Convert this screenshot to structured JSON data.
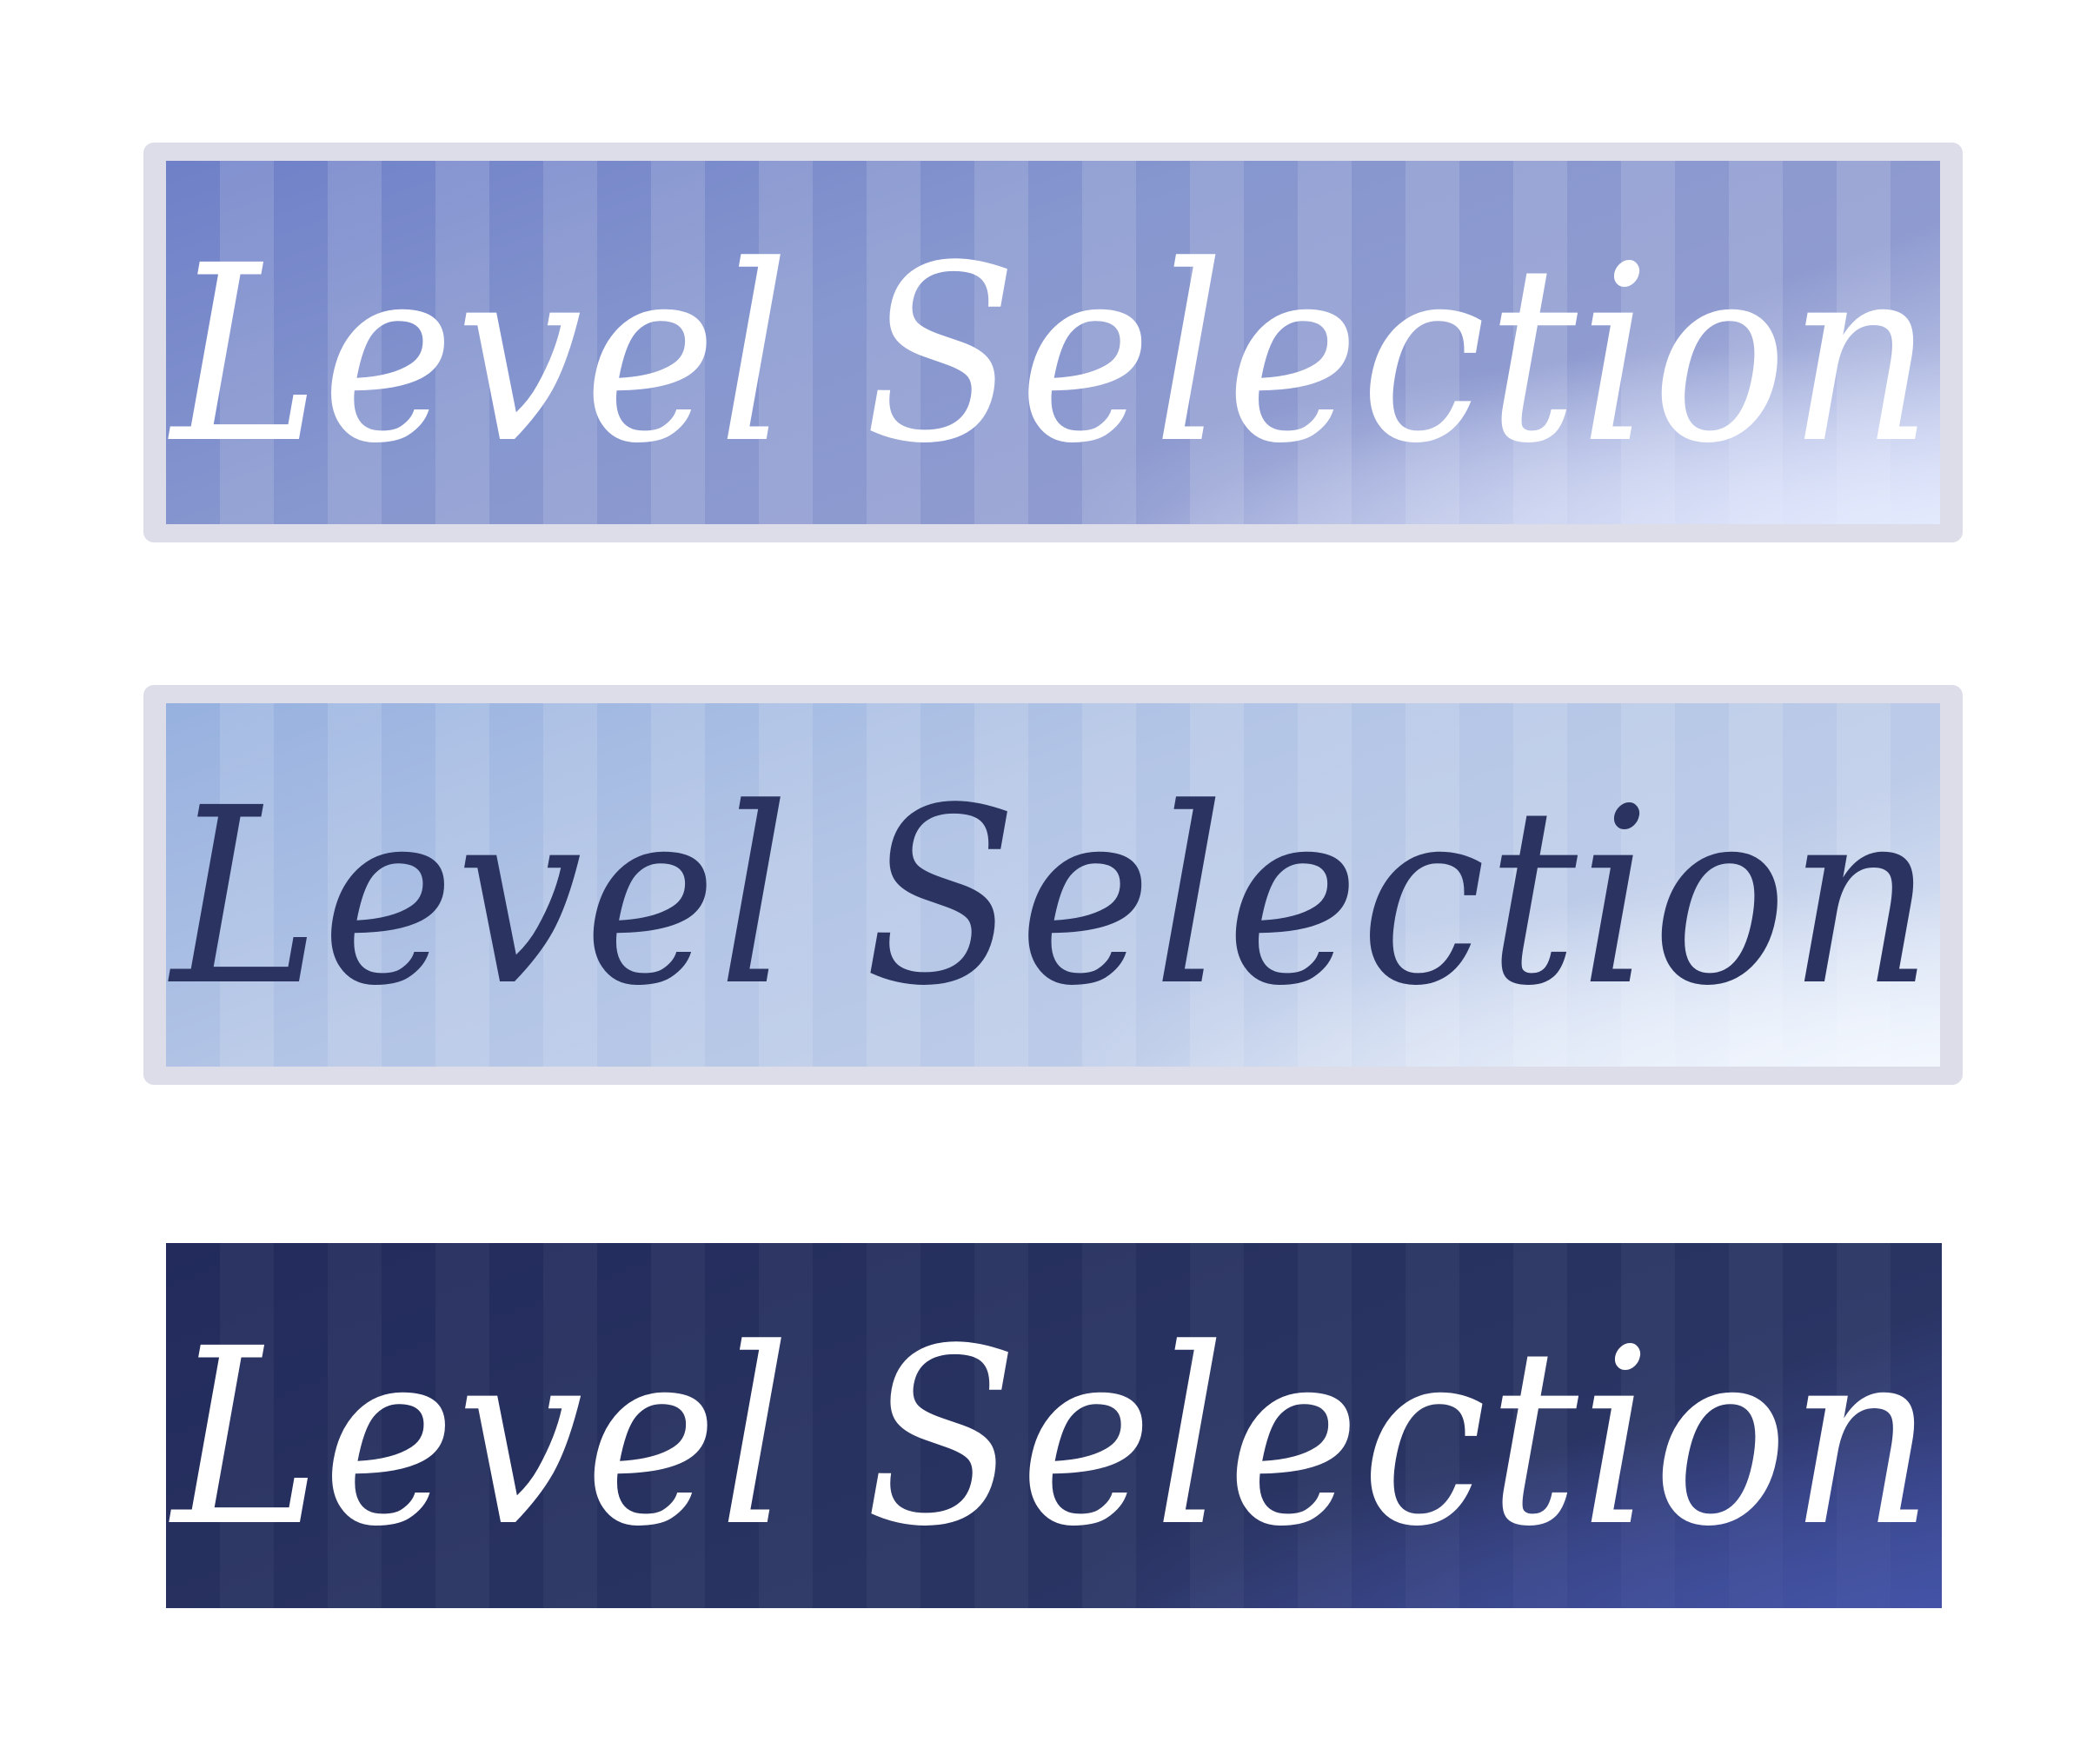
{
  "buttons": [
    {
      "state": "normal",
      "label": "Level Selection",
      "bg_color": "#7f8fcc",
      "text_color": "#ffffff",
      "frame_color": "#dcdde9"
    },
    {
      "state": "hover",
      "label": "Level Selection",
      "bg_color": "#b4c6e6",
      "text_color": "#2b3361",
      "frame_color": "#dcdde9"
    },
    {
      "state": "pressed",
      "label": "Level Selection",
      "bg_color": "#28315e",
      "text_color": "#ffffff"
    }
  ]
}
